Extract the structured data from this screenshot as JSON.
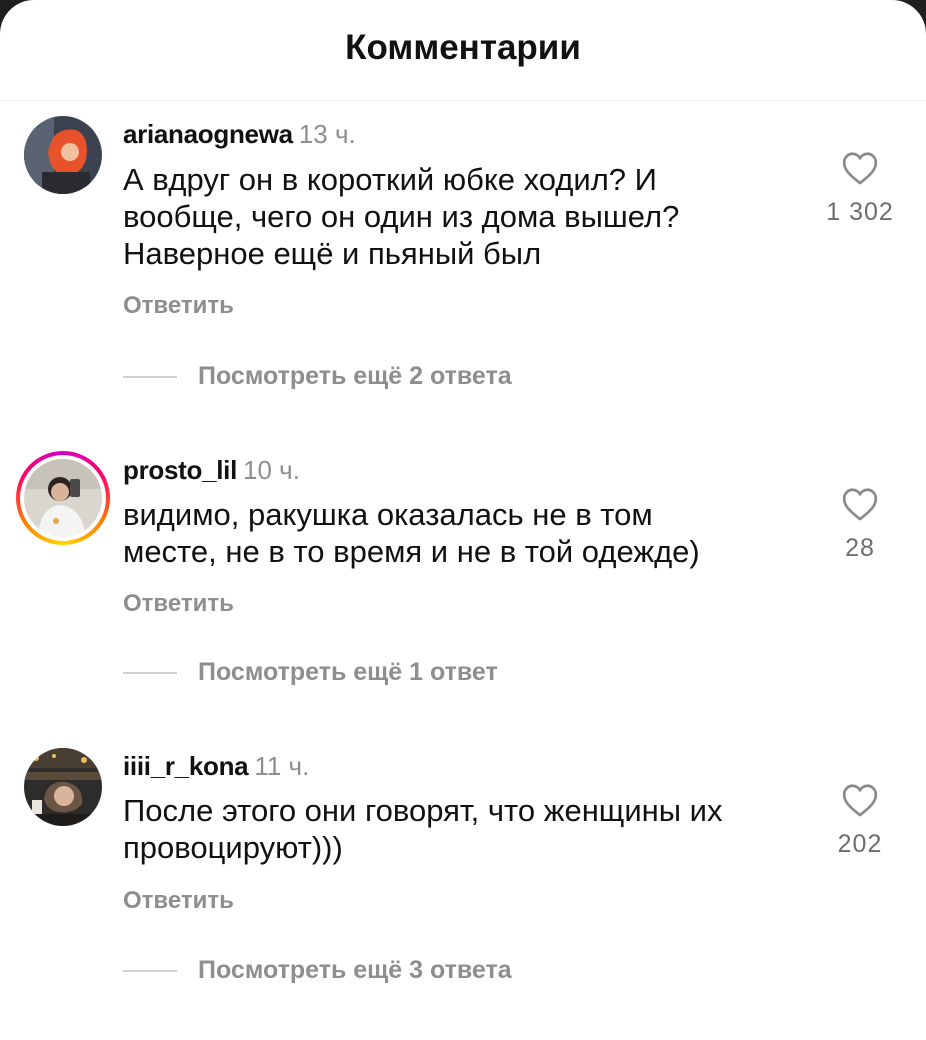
{
  "header": {
    "title": "Комментарии"
  },
  "comments": [
    {
      "username": "arianaognewa",
      "time": "13 ч.",
      "text_lines": [
        "А вдруг он в короткий юбке ходил? И",
        "вообще, чего он один из дома вышел?",
        "Наверное ещё и пьяный был"
      ],
      "reply_label": "Ответить",
      "view_more": "Посмотреть ещё 2 ответа",
      "likes": "1 302",
      "has_story": false
    },
    {
      "username": "prosto_lil",
      "time": "10 ч.",
      "text_lines": [
        "видимо, ракушка оказалась не в том",
        "месте, не в то время и не в той одежде)"
      ],
      "reply_label": "Ответить",
      "view_more": "Посмотреть ещё 1 ответ",
      "likes": "28",
      "has_story": true
    },
    {
      "username": "iiii_r_kona",
      "time": "11 ч.",
      "text_lines": [
        "После этого они говорят, что женщины их",
        "провоцируют)))"
      ],
      "reply_label": "Ответить",
      "view_more": "Посмотреть ещё 3 ответа",
      "likes": "202",
      "has_story": false
    }
  ],
  "icons": {
    "like": "heart-outline-icon"
  },
  "colors": {
    "secondary_text": "#8e8e8e",
    "story_ring": [
      "#d300c5",
      "#ff0069",
      "#ffd600"
    ]
  }
}
